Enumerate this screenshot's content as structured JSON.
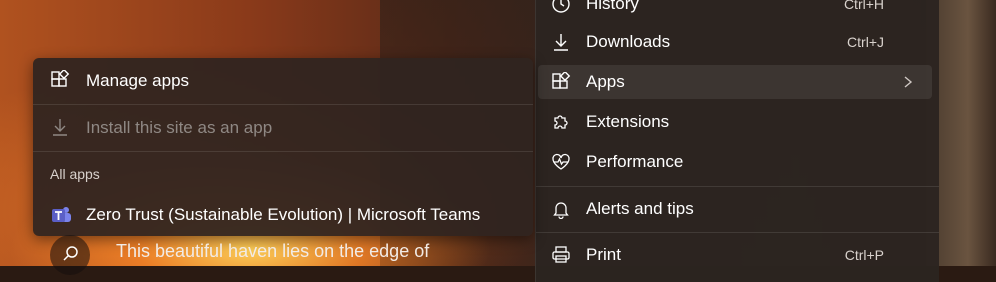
{
  "main_menu": {
    "items": [
      {
        "label": "History",
        "shortcut": "Ctrl+H",
        "icon": "history-icon"
      },
      {
        "label": "Downloads",
        "shortcut": "Ctrl+J",
        "icon": "download-icon"
      },
      {
        "label": "Apps",
        "shortcut": "",
        "icon": "apps-icon"
      },
      {
        "label": "Extensions",
        "shortcut": "",
        "icon": "extensions-icon"
      },
      {
        "label": "Performance",
        "shortcut": "",
        "icon": "performance-icon"
      },
      {
        "label": "Alerts and tips",
        "shortcut": "",
        "icon": "bell-icon"
      },
      {
        "label": "Print",
        "shortcut": "Ctrl+P",
        "icon": "print-icon"
      }
    ]
  },
  "apps_submenu": {
    "manage": "Manage apps",
    "install": "Install this site as an app",
    "heading": "All apps",
    "apps": [
      {
        "label": "Zero Trust (Sustainable Evolution) | Microsoft Teams",
        "icon": "teams-icon"
      }
    ]
  },
  "background": {
    "caption": "This beautiful haven lies on the edge of"
  },
  "colors": {
    "menu_bg": "#2c2420",
    "text": "#ffffff",
    "disabled_text": "#8f8884",
    "teams_purple": "#5b5fc7"
  }
}
